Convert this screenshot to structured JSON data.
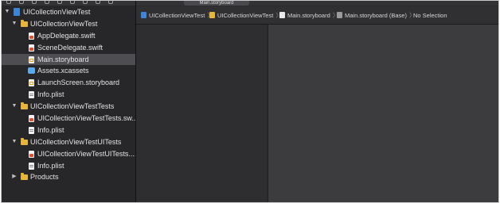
{
  "editor_tab": {
    "label": "Main.storyboard"
  },
  "navigator": {
    "items": [
      {
        "label": "UICollectionViewTest",
        "icon": "project-icon",
        "disclosure": "open",
        "selected": false
      },
      {
        "label": "UICollectionViewTest",
        "icon": "folder-icon",
        "disclosure": "open",
        "selected": false
      },
      {
        "label": "AppDelegate.swift",
        "icon": "swift-file-icon",
        "selected": false
      },
      {
        "label": "SceneDelegate.swift",
        "icon": "swift-file-icon",
        "selected": false
      },
      {
        "label": "Main.storyboard",
        "icon": "storyboard-file-icon",
        "selected": true
      },
      {
        "label": "Assets.xcassets",
        "icon": "assets-folder-icon",
        "selected": false
      },
      {
        "label": "LaunchScreen.storyboard",
        "icon": "storyboard-file-icon",
        "selected": false
      },
      {
        "label": "Info.plist",
        "icon": "plist-file-icon",
        "selected": false
      },
      {
        "label": "UICollectionViewTestTests",
        "icon": "folder-icon",
        "disclosure": "open",
        "selected": false
      },
      {
        "label": "UICollectionViewTestTests.sw...",
        "icon": "swift-file-icon",
        "selected": false
      },
      {
        "label": "Info.plist",
        "icon": "plist-file-icon",
        "selected": false
      },
      {
        "label": "UICollectionViewTestUITests",
        "icon": "folder-icon",
        "disclosure": "open",
        "selected": false
      },
      {
        "label": "UICollectionViewTestUITests....",
        "icon": "swift-file-icon",
        "selected": false
      },
      {
        "label": "Info.plist",
        "icon": "plist-file-icon",
        "selected": false
      },
      {
        "label": "Products",
        "icon": "folder-icon",
        "disclosure": "closed",
        "selected": false
      }
    ]
  },
  "jumpbar": {
    "crumbs": [
      {
        "label": "UICollectionViewTest",
        "icon": "project-icon"
      },
      {
        "label": "UICollectionViewTest",
        "icon": "folder-icon"
      },
      {
        "label": "Main.storyboard",
        "icon": "storyboard-file-icon"
      },
      {
        "label": "Main.storyboard (Base)",
        "icon": "storyboard-base-icon"
      },
      {
        "label": "No Selection",
        "icon": ""
      }
    ]
  },
  "colors": {
    "selection": "#4d4d52",
    "folder": "#e7b53c",
    "project": "#3b86d6",
    "background": "#2b2b2d"
  }
}
